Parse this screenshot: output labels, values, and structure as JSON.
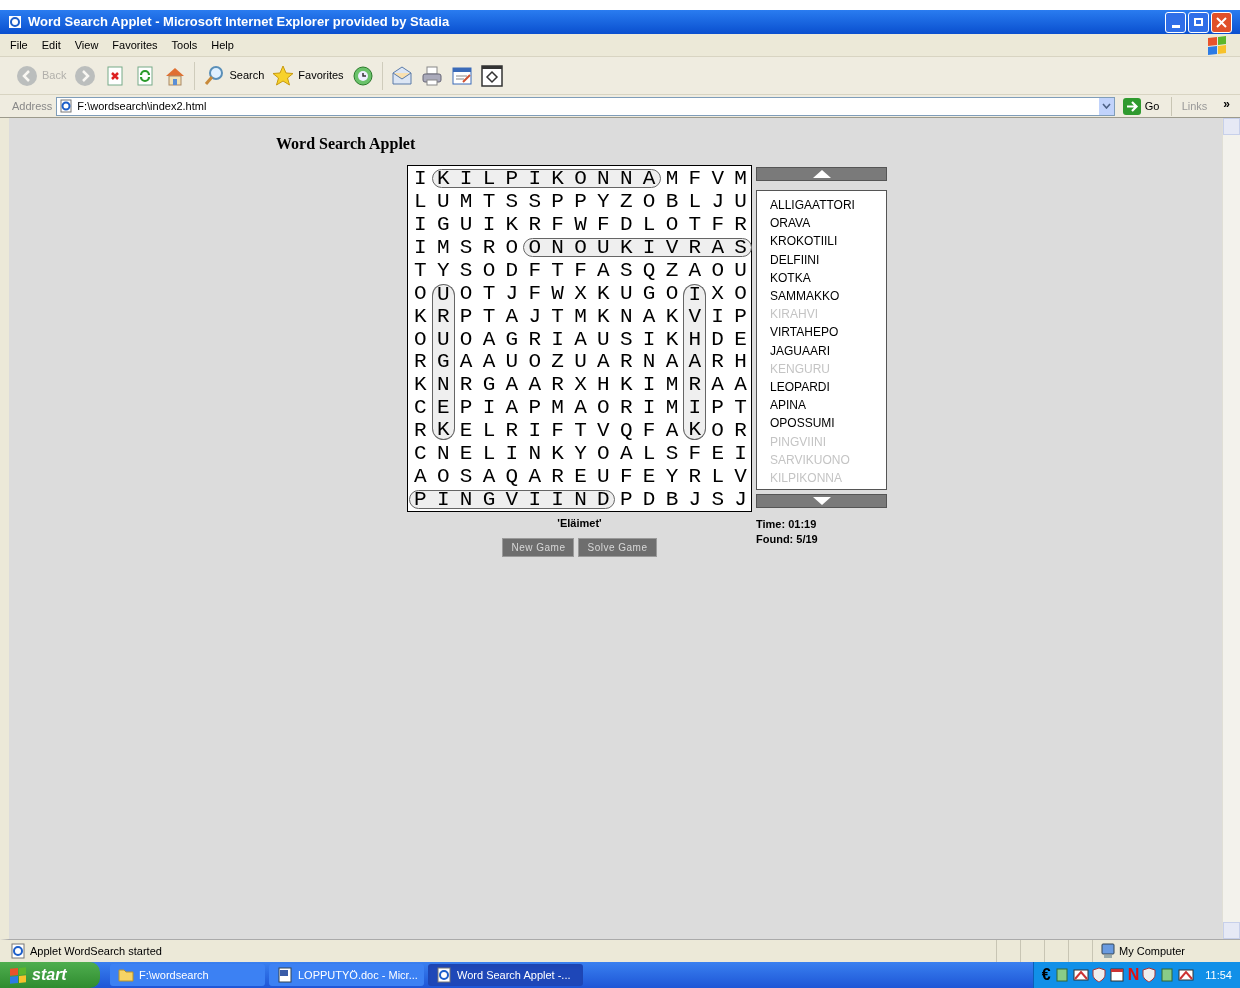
{
  "window": {
    "title": "Word Search Applet - Microsoft Internet Explorer provided by Stadia"
  },
  "menu": [
    "File",
    "Edit",
    "View",
    "Favorites",
    "Tools",
    "Help"
  ],
  "toolbar": [
    {
      "kind": "back",
      "label": "Back",
      "disabled": true
    },
    {
      "kind": "forward",
      "disabled": true
    },
    {
      "kind": "stop",
      "disabled": false
    },
    {
      "kind": "refresh",
      "disabled": false
    },
    {
      "kind": "home",
      "disabled": false
    },
    {
      "kind": "search",
      "label": "Search",
      "disabled": false
    },
    {
      "kind": "favorites",
      "label": "Favorites",
      "disabled": false
    },
    {
      "kind": "history",
      "disabled": false
    },
    {
      "kind": "mail",
      "disabled": false
    },
    {
      "kind": "print",
      "disabled": false
    },
    {
      "kind": "edit",
      "disabled": false
    },
    {
      "kind": "frame",
      "disabled": false
    }
  ],
  "address": {
    "label": "Address",
    "value": "F:\\wordsearch\\index2.html",
    "go": "Go",
    "links": "Links",
    "more": "»"
  },
  "page": {
    "heading": "Word Search Applet",
    "grid": [
      {
        "segments": [
          {
            "text": "I",
            "marked": false
          },
          {
            "text": "KILPIKONNA",
            "marked": true
          },
          {
            "text": "MFVM",
            "marked": false
          }
        ]
      },
      {
        "segments": [
          {
            "text": "LUMTSSPPYZOBLJU",
            "marked": false
          }
        ]
      },
      {
        "segments": [
          {
            "text": "IGUIKRFWFDLOTFR",
            "marked": false
          }
        ]
      },
      {
        "segments": [
          {
            "text": "IMSRO",
            "marked": false
          },
          {
            "text": "ONOUKIVRAS",
            "marked": true
          }
        ]
      },
      {
        "segments": [
          {
            "text": "TYSODFTFASQZAOU",
            "marked": false
          }
        ]
      },
      {
        "segments": [
          {
            "text": "O",
            "marked": false
          },
          {
            "text": "U",
            "marked": true
          },
          {
            "text": "OTJFWXKUGO",
            "marked": false
          },
          {
            "text": "I",
            "marked": true
          },
          {
            "text": "XO",
            "marked": false
          }
        ]
      },
      {
        "segments": [
          {
            "text": "K",
            "marked": false
          },
          {
            "text": "R",
            "marked": true
          },
          {
            "text": "PTAJTMKNAK",
            "marked": false
          },
          {
            "text": "V",
            "marked": true
          },
          {
            "text": "IP",
            "marked": false
          }
        ]
      },
      {
        "segments": [
          {
            "text": "O",
            "marked": false
          },
          {
            "text": "U",
            "marked": true
          },
          {
            "text": "OAGRIAUSIK",
            "marked": false
          },
          {
            "text": "H",
            "marked": true
          },
          {
            "text": "DE",
            "marked": false
          }
        ]
      },
      {
        "segments": [
          {
            "text": "R",
            "marked": false
          },
          {
            "text": "G",
            "marked": true
          },
          {
            "text": "AAUOZUARNA",
            "marked": false
          },
          {
            "text": "A",
            "marked": true
          },
          {
            "text": "RH",
            "marked": false
          }
        ]
      },
      {
        "segments": [
          {
            "text": "K",
            "marked": false
          },
          {
            "text": "N",
            "marked": true
          },
          {
            "text": "RGAARXHKIM",
            "marked": false
          },
          {
            "text": "R",
            "marked": true
          },
          {
            "text": "AA",
            "marked": false
          }
        ]
      },
      {
        "segments": [
          {
            "text": "C",
            "marked": false
          },
          {
            "text": "E",
            "marked": true
          },
          {
            "text": "PIAPMAORIM",
            "marked": false
          },
          {
            "text": "I",
            "marked": true
          },
          {
            "text": "PT",
            "marked": false
          }
        ]
      },
      {
        "segments": [
          {
            "text": "R",
            "marked": false
          },
          {
            "text": "K",
            "marked": true
          },
          {
            "text": "ELRIFTVQFA",
            "marked": false
          },
          {
            "text": "K",
            "marked": true
          },
          {
            "text": "OR",
            "marked": false
          }
        ]
      },
      {
        "segments": [
          {
            "text": "CNELINKYOALSFEI",
            "marked": false
          }
        ]
      },
      {
        "segments": [
          {
            "text": "AOSAQAREUFEYRLV",
            "marked": false
          }
        ]
      },
      {
        "segments": [
          {
            "text": "PINGVIIND",
            "marked": true
          },
          {
            "text": "PDBJSJ",
            "marked": false
          }
        ]
      }
    ],
    "words": [
      {
        "text": "ALLIGAATTORI",
        "found": false
      },
      {
        "text": "ORAVA",
        "found": false
      },
      {
        "text": "KROKOTIILI",
        "found": false
      },
      {
        "text": "DELFIINI",
        "found": false
      },
      {
        "text": "KOTKA",
        "found": false
      },
      {
        "text": "SAMMAKKO",
        "found": false
      },
      {
        "text": "KIRAHVI",
        "found": true
      },
      {
        "text": "VIRTAHEPO",
        "found": false
      },
      {
        "text": "JAGUAARI",
        "found": false
      },
      {
        "text": "KENGURU",
        "found": true
      },
      {
        "text": "LEOPARDI",
        "found": false
      },
      {
        "text": "APINA",
        "found": false
      },
      {
        "text": "OPOSSUMI",
        "found": false
      },
      {
        "text": "PINGVIINI",
        "found": true
      },
      {
        "text": "SARVIKUONO",
        "found": true
      },
      {
        "text": "KILPIKONNA",
        "found": true
      }
    ],
    "category": "'Eläimet'",
    "time": "Time: 01:19",
    "found": "Found: 5/19",
    "buttons": [
      "New Game",
      "Solve Game"
    ]
  },
  "status_bar": {
    "text": "Applet WordSearch started",
    "zone": "My Computer"
  },
  "taskbar": {
    "start": "start",
    "tasks": [
      {
        "kind": "folder",
        "label": "F:\\wordsearch",
        "selected": false
      },
      {
        "kind": "document",
        "label": "LOPPUTYÖ.doc - Micr...",
        "selected": false
      },
      {
        "kind": "browser",
        "label": "Word Search Applet -...",
        "selected": true
      }
    ],
    "tray": [
      {
        "kind": "glyph",
        "text": "€"
      },
      {
        "kind": "icon"
      },
      {
        "kind": "icon"
      },
      {
        "kind": "shield"
      },
      {
        "kind": "icon"
      },
      {
        "kind": "glyph",
        "text": "N"
      },
      {
        "kind": "shield"
      },
      {
        "kind": "icon"
      },
      {
        "kind": "icon"
      }
    ],
    "clock": "11:54"
  }
}
